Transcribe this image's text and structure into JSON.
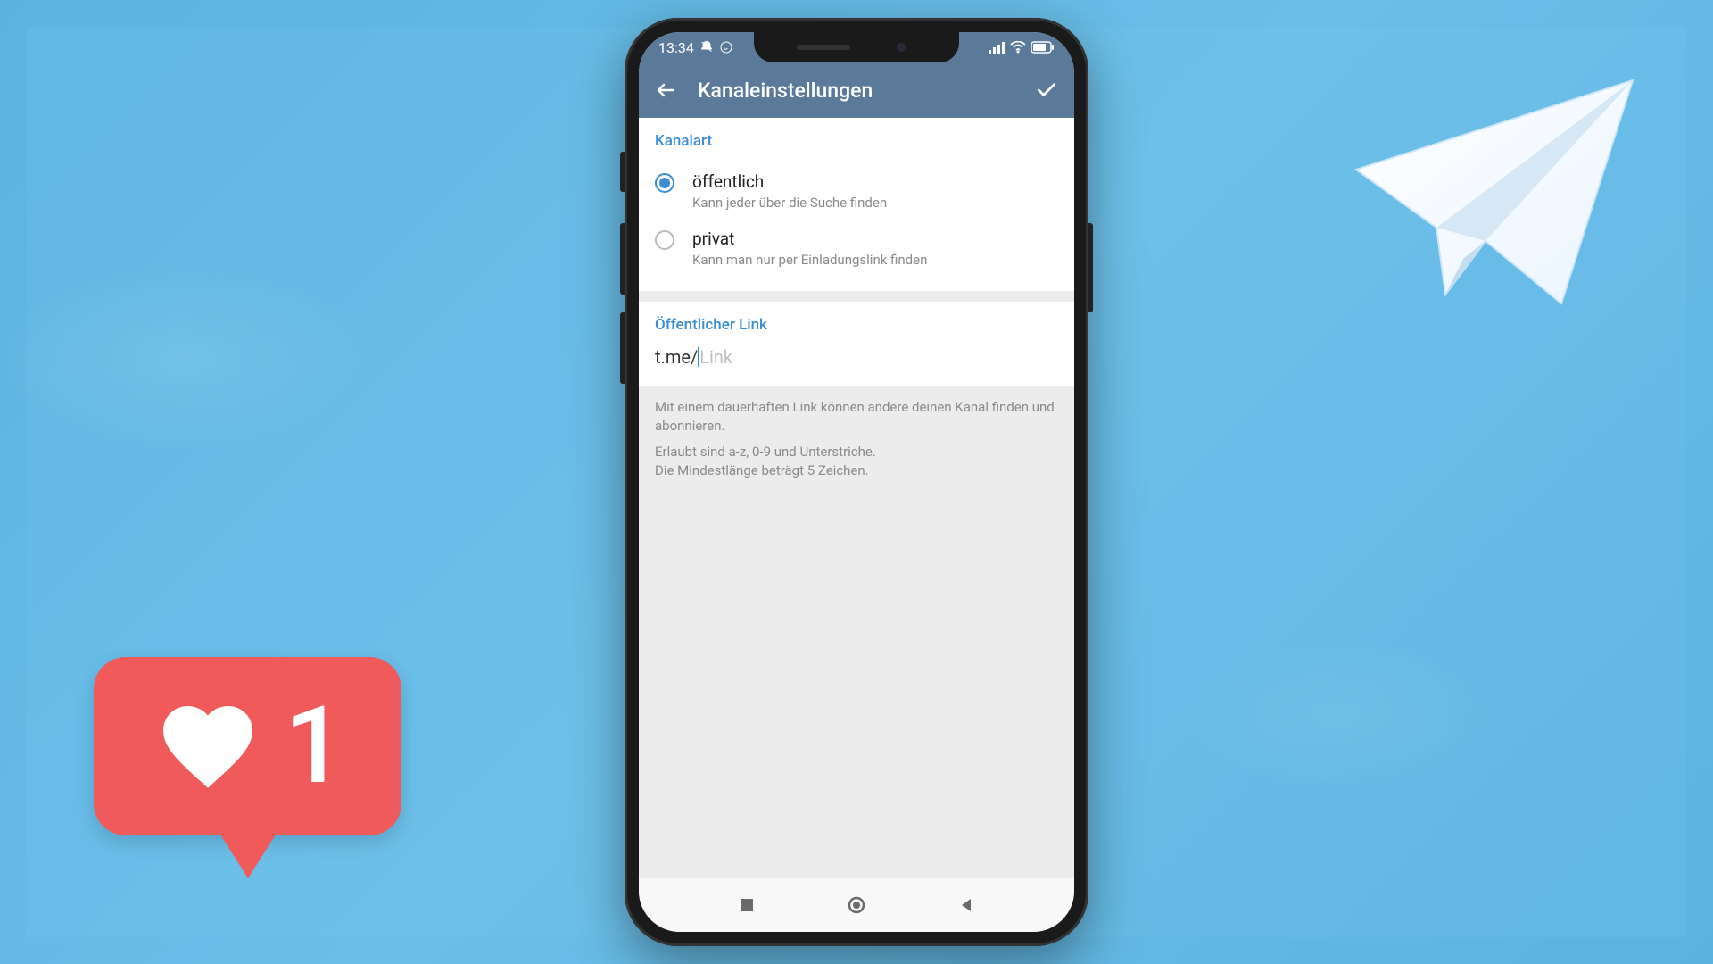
{
  "statusbar": {
    "time": "13:34"
  },
  "appbar": {
    "title": "Kanaleinstellungen"
  },
  "channel_type": {
    "header": "Kanalart",
    "options": [
      {
        "title": "öffentlich",
        "subtitle": "Kann jeder über die Suche finden",
        "selected": true
      },
      {
        "title": "privat",
        "subtitle": "Kann man nur per Einladungslink finden",
        "selected": false
      }
    ]
  },
  "public_link": {
    "header": "Öffentlicher Link",
    "prefix": "t.me/",
    "placeholder": "Link"
  },
  "helper": {
    "line1": "Mit einem dauerhaften Link können andere deinen Kanal finden und abonnieren.",
    "line2": "Erlaubt sind a-z, 0-9 und Unterstriche.",
    "line3": "Die Mindestlänge beträgt 5 Zeichen."
  },
  "like": {
    "count": "1"
  }
}
